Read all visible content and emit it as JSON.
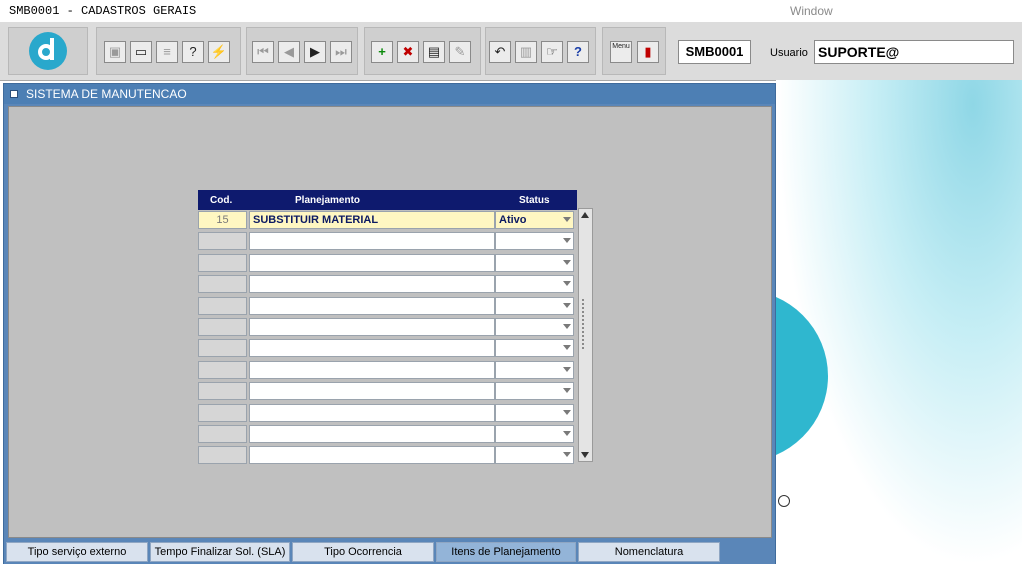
{
  "window": {
    "app_title": "SMB0001 - CADASTROS GERAIS",
    "menu_window": "Window"
  },
  "toolbar": {
    "form_code": "SMB0001",
    "user_label": "Usuario",
    "user_value": "SUPORTE@",
    "menu_button_label": "Menu",
    "buttons": [
      {
        "name": "save",
        "icon": "floppy-icon"
      },
      {
        "name": "print-preview",
        "icon": "monitor-icon"
      },
      {
        "name": "print",
        "icon": "printer-icon"
      },
      {
        "name": "query",
        "icon": "query-icon"
      },
      {
        "name": "execute-query",
        "icon": "lightning-icon"
      },
      {
        "name": "first-record",
        "icon": "first-icon"
      },
      {
        "name": "prev-record",
        "icon": "prev-icon"
      },
      {
        "name": "next-record",
        "icon": "next-icon"
      },
      {
        "name": "last-record",
        "icon": "last-icon"
      },
      {
        "name": "insert-record",
        "icon": "plus-icon"
      },
      {
        "name": "delete-record",
        "icon": "x-icon"
      },
      {
        "name": "clear-record",
        "icon": "eraser-icon"
      },
      {
        "name": "edit",
        "icon": "pencil-icon"
      },
      {
        "name": "undo",
        "icon": "undo-icon"
      },
      {
        "name": "clipboard",
        "icon": "clipboard-icon"
      },
      {
        "name": "list-values",
        "icon": "hand-icon"
      },
      {
        "name": "help",
        "icon": "question-icon"
      },
      {
        "name": "exit",
        "icon": "exit-door-icon"
      }
    ]
  },
  "form": {
    "title": "SISTEMA DE MANUTENCAO",
    "grid": {
      "headers": [
        "Cod.",
        "Planejamento",
        "Status"
      ],
      "rows": [
        {
          "cod": "15",
          "planejamento": "SUBSTITUIR MATERIAL",
          "status": "Ativo"
        },
        {
          "cod": "",
          "planejamento": "",
          "status": ""
        },
        {
          "cod": "",
          "planejamento": "",
          "status": ""
        },
        {
          "cod": "",
          "planejamento": "",
          "status": ""
        },
        {
          "cod": "",
          "planejamento": "",
          "status": ""
        },
        {
          "cod": "",
          "planejamento": "",
          "status": ""
        },
        {
          "cod": "",
          "planejamento": "",
          "status": ""
        },
        {
          "cod": "",
          "planejamento": "",
          "status": ""
        },
        {
          "cod": "",
          "planejamento": "",
          "status": ""
        },
        {
          "cod": "",
          "planejamento": "",
          "status": ""
        },
        {
          "cod": "",
          "planejamento": "",
          "status": ""
        },
        {
          "cod": "",
          "planejamento": "",
          "status": ""
        }
      ]
    },
    "tabs": [
      {
        "label": "Tipo serviço externo",
        "selected": false
      },
      {
        "label": "Tempo Finalizar Sol. (SLA)",
        "selected": false
      },
      {
        "label": "Tipo Ocorrencia",
        "selected": false
      },
      {
        "label": "Itens de Planejamento",
        "selected": true
      },
      {
        "label": "Nomenclatura",
        "selected": false
      }
    ]
  }
}
